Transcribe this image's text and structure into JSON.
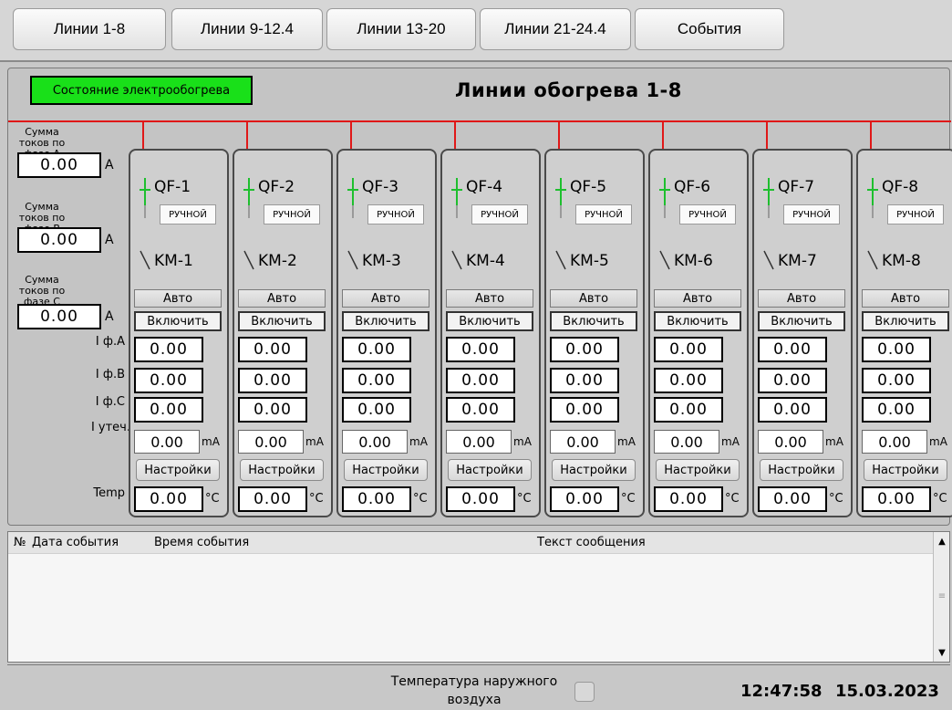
{
  "tabs": [
    {
      "label": "Линии 1-8"
    },
    {
      "label": "Линии 9-12.4"
    },
    {
      "label": "Линии 13-20"
    },
    {
      "label": "Линии 21-24.4"
    },
    {
      "label": "События"
    }
  ],
  "header": {
    "state_button": "Состояние электрообогрева",
    "title": "Линии обогрева 1-8"
  },
  "sums": {
    "phase_a_label": "Сумма токов по фазе А",
    "phase_a_value": "0.00",
    "phase_b_label": "Сумма токов по фазе В",
    "phase_b_value": "0.00",
    "phase_c_label": "Сумма токов по фазе С",
    "phase_c_value": "0.00",
    "unit": "А"
  },
  "row_labels": {
    "ia": "I ф.А",
    "ib": "I ф.В",
    "ic": "I ф.С",
    "leak": "I утеч.",
    "temp": "Temp"
  },
  "units": {
    "ma": "mA",
    "degc": "°C"
  },
  "colors": {
    "state_ok": "#19e019",
    "bus_line": "#e01818",
    "breaker_on": "#1ebf2e"
  },
  "lines": [
    {
      "qf": "QF-1",
      "mode": "РУЧНОЙ",
      "km": "KM-1",
      "auto": "Авто",
      "on": "Включить",
      "ia": "0.00",
      "ib": "0.00",
      "ic": "0.00",
      "leak": "0.00",
      "settings": "Настройки",
      "temp": "0.00"
    },
    {
      "qf": "QF-2",
      "mode": "РУЧНОЙ",
      "km": "KM-2",
      "auto": "Авто",
      "on": "Включить",
      "ia": "0.00",
      "ib": "0.00",
      "ic": "0.00",
      "leak": "0.00",
      "settings": "Настройки",
      "temp": "0.00"
    },
    {
      "qf": "QF-3",
      "mode": "РУЧНОЙ",
      "km": "KM-3",
      "auto": "Авто",
      "on": "Включить",
      "ia": "0.00",
      "ib": "0.00",
      "ic": "0.00",
      "leak": "0.00",
      "settings": "Настройки",
      "temp": "0.00"
    },
    {
      "qf": "QF-4",
      "mode": "РУЧНОЙ",
      "km": "KM-4",
      "auto": "Авто",
      "on": "Включить",
      "ia": "0.00",
      "ib": "0.00",
      "ic": "0.00",
      "leak": "0.00",
      "settings": "Настройки",
      "temp": "0.00"
    },
    {
      "qf": "QF-5",
      "mode": "РУЧНОЙ",
      "km": "KM-5",
      "auto": "Авто",
      "on": "Включить",
      "ia": "0.00",
      "ib": "0.00",
      "ic": "0.00",
      "leak": "0.00",
      "settings": "Настройки",
      "temp": "0.00"
    },
    {
      "qf": "QF-6",
      "mode": "РУЧНОЙ",
      "km": "KM-6",
      "auto": "Авто",
      "on": "Включить",
      "ia": "0.00",
      "ib": "0.00",
      "ic": "0.00",
      "leak": "0.00",
      "settings": "Настройки",
      "temp": "0.00"
    },
    {
      "qf": "QF-7",
      "mode": "РУЧНОЙ",
      "km": "KM-7",
      "auto": "Авто",
      "on": "Включить",
      "ia": "0.00",
      "ib": "0.00",
      "ic": "0.00",
      "leak": "0.00",
      "settings": "Настройки",
      "temp": "0.00"
    },
    {
      "qf": "QF-8",
      "mode": "РУЧНОЙ",
      "km": "KM-8",
      "auto": "Авто",
      "on": "Включить",
      "ia": "0.00",
      "ib": "0.00",
      "ic": "0.00",
      "leak": "0.00",
      "settings": "Настройки",
      "temp": "0.00"
    }
  ],
  "events": {
    "columns": [
      "№",
      "Дата события",
      "Время события",
      "Текст сообщения"
    ],
    "rows": []
  },
  "footer": {
    "outside_temp_label": "Температура наружного воздуха",
    "time": "12:47:58",
    "date": "15.03.2023"
  }
}
